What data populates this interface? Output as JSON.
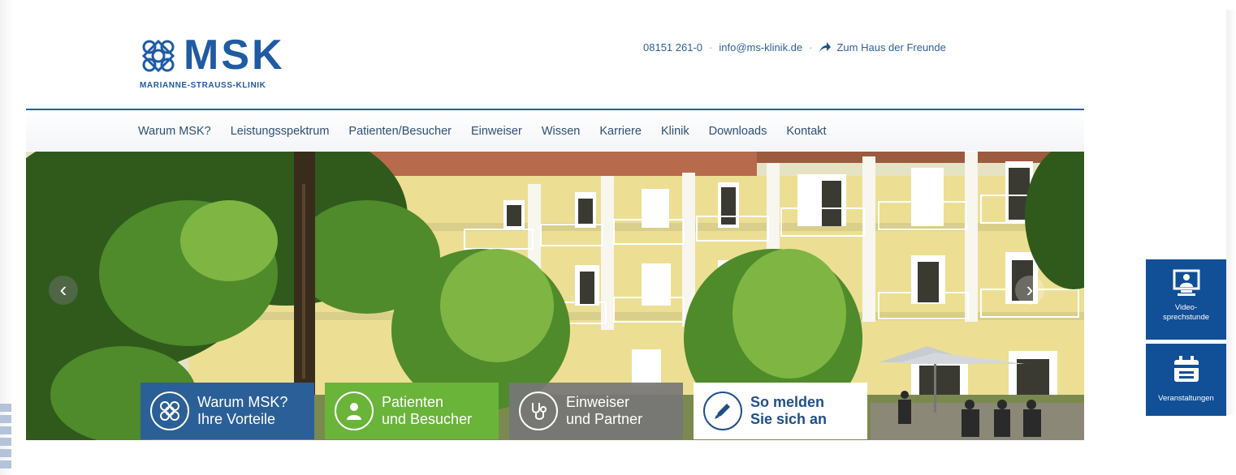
{
  "brand": {
    "logo_text": "MSK",
    "logo_subtitle": "MARIANNE-STRAUSS-KLINIK",
    "primary_color": "#1f5ba3",
    "accent_green": "#6ab43a",
    "accent_gray": "#767676"
  },
  "contact": {
    "phone": "08151 261-0",
    "separator": "·",
    "email": "info@ms-klinik.de",
    "link_icon": "arrow-right-icon",
    "link_label": "Zum Haus der Freunde"
  },
  "nav": {
    "items": [
      "Warum MSK?",
      "Leistungsspektrum",
      "Patienten/Besucher",
      "Einweiser",
      "Wissen",
      "Karriere",
      "Klinik",
      "Downloads",
      "Kontakt"
    ]
  },
  "hero": {
    "prev_label": "‹",
    "next_label": "›"
  },
  "tiles": [
    {
      "line1": "Warum MSK?",
      "line2": "Ihre Vorteile",
      "icon": "knot-logo-icon"
    },
    {
      "line1": "Patienten",
      "line2": "und Besucher",
      "icon": "person-icon"
    },
    {
      "line1": "Einweiser",
      "line2": "und Partner",
      "icon": "stethoscope-icon"
    },
    {
      "line1": "So melden",
      "line2": "Sie sich an",
      "icon": "pen-icon"
    }
  ],
  "side_buttons": [
    {
      "line1": "Video-",
      "line2": "sprechstunde",
      "icon": "video-call-icon"
    },
    {
      "line1": "Veranstaltungen",
      "icon": "calendar-icon"
    }
  ]
}
